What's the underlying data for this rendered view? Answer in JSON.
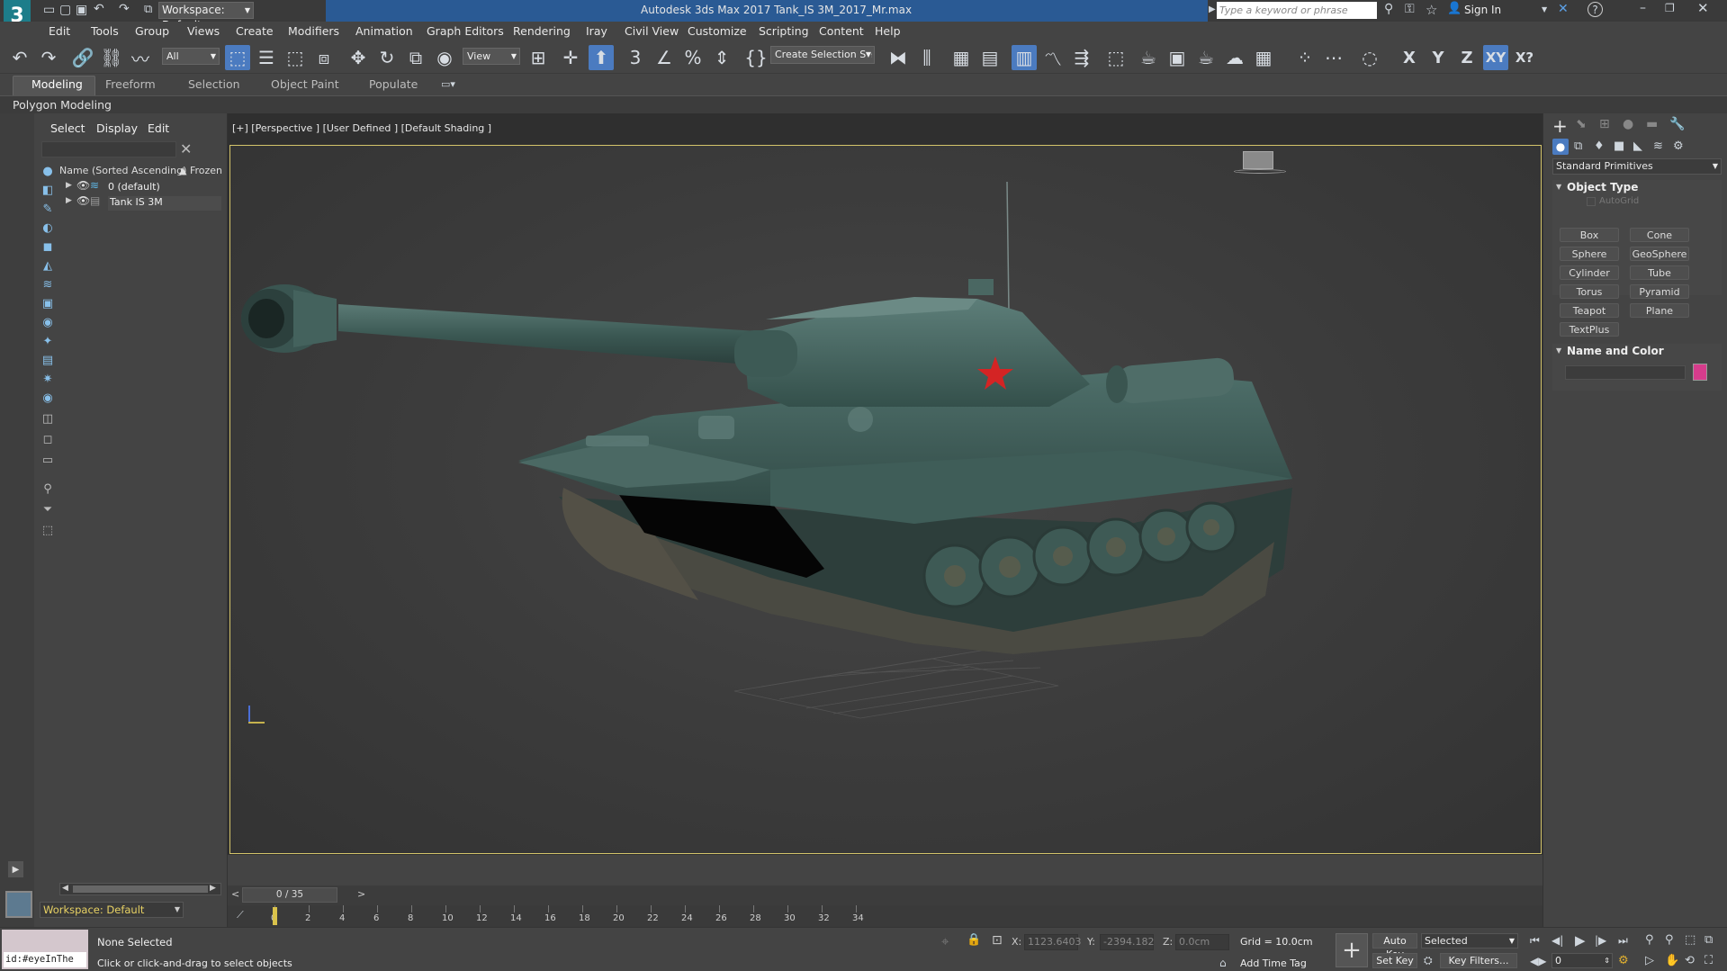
{
  "titlebar": {
    "workspace": "Workspace: Default",
    "title": "Autodesk 3ds Max 2017     Tank_IS 3M_2017_Mr.max",
    "search_placeholder": "Type a keyword or phrase",
    "sign_in": "Sign In",
    "logo": "3"
  },
  "menu": [
    "Edit",
    "Tools",
    "Group",
    "Views",
    "Create",
    "Modifiers",
    "Animation",
    "Graph Editors",
    "Rendering",
    "Iray",
    "Civil View",
    "Customize",
    "Scripting",
    "Content",
    "Help"
  ],
  "toolbar": {
    "filter_value": "All",
    "refcoord_value": "View",
    "selection_set_value": "Create Selection Se",
    "axis": [
      "X",
      "Y",
      "Z",
      "XY",
      "X?"
    ]
  },
  "ribbon": {
    "tabs": [
      "Modeling",
      "Freeform",
      "Selection",
      "Object Paint",
      "Populate"
    ],
    "active_tab": "Modeling",
    "subpanel": "Polygon Modeling"
  },
  "explorer": {
    "menus": [
      "Select",
      "Display",
      "Edit"
    ],
    "column_name": "Name (Sorted Ascending)",
    "column_frozen": "▲ Frozen",
    "items": [
      "0 (default)",
      "Tank IS 3M"
    ],
    "workspace": "Workspace: Default"
  },
  "viewport": {
    "label": "[+] [Perspective ] [User Defined ] [Default Shading ]"
  },
  "cmdpanel": {
    "category": "Standard Primitives",
    "object_type_title": "Object Type",
    "autogrid": "AutoGrid",
    "primitives": [
      "Box",
      "Cone",
      "Sphere",
      "GeoSphere",
      "Cylinder",
      "Tube",
      "Torus",
      "Pyramid",
      "Teapot",
      "Plane",
      "TextPlus"
    ],
    "name_color_title": "Name and Color",
    "swatch_color": "#d63c8c"
  },
  "timeline": {
    "frame_label": "0 / 35",
    "ticks": [
      "0",
      "2",
      "4",
      "6",
      "8",
      "10",
      "12",
      "14",
      "16",
      "18",
      "20",
      "22",
      "24",
      "26",
      "28",
      "30",
      "32",
      "34"
    ]
  },
  "status": {
    "selection": "None Selected",
    "prompt": "Click or click-and-drag to select objects",
    "listener": "id:#eyeInThe",
    "x_label": "X:",
    "x_value": "1123.6403",
    "y_label": "Y:",
    "y_value": "-2394.182",
    "z_label": "Z:",
    "z_value": "0.0cm",
    "grid": "Grid = 10.0cm",
    "add_time_tag": "Add Time Tag",
    "auto_key": "Auto Key",
    "set_key": "Set Key",
    "selected": "Selected",
    "key_filters": "Key Filters...",
    "frame": "0"
  },
  "colors": {
    "accent_blue": "#4b7bc0",
    "viewport_border": "#d4c46a",
    "title_blue": "#2a5a94",
    "star_red": "#d42424"
  }
}
